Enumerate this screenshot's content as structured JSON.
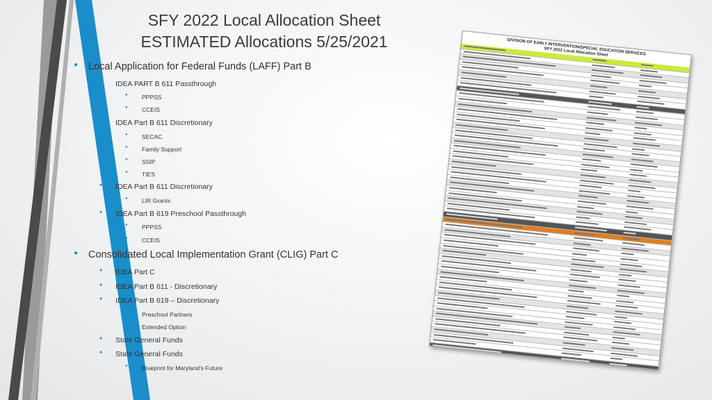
{
  "slide": {
    "title_line1": "SFY 2022 Local Allocation Sheet",
    "title_line2": "ESTIMATED Allocations 5/25/2021"
  },
  "outline": [
    {
      "level": 1,
      "text": "Local Application for Federal Funds (LAFF) Part B"
    },
    {
      "level": 2,
      "text": "IDEA PART B 611 Passthrough"
    },
    {
      "level": 3,
      "text": "PPPSS"
    },
    {
      "level": 3,
      "text": "CCEIS"
    },
    {
      "level": 2,
      "text": "IDEA Part B 611 Discretionary"
    },
    {
      "level": 3,
      "text": "SECAC"
    },
    {
      "level": 3,
      "text": "Family Support"
    },
    {
      "level": 3,
      "text": "SSIP"
    },
    {
      "level": 3,
      "text": "TIES"
    },
    {
      "level": 2,
      "text": "IDEA Part B 611 Discretionary"
    },
    {
      "level": 3,
      "text": "LIR Grants"
    },
    {
      "level": 2,
      "text": "IDEA Part B 619 Preschool Passthrough"
    },
    {
      "level": 3,
      "text": "PPPSS"
    },
    {
      "level": 3,
      "text": "CCEIS"
    },
    {
      "level": 1,
      "text": "Consolidated Local Implementation Grant (CLIG) Part C"
    },
    {
      "level": 2,
      "text": "IDEA Part C"
    },
    {
      "level": 2,
      "text": "IDEA Part B 611 - Discretionary"
    },
    {
      "level": 2,
      "text": "IDEA Part B 619 – Discretionary"
    },
    {
      "level": 3,
      "text": "Preschool Partners"
    },
    {
      "level": 3,
      "text": "Extended Option"
    },
    {
      "level": 2,
      "text": "State General Funds"
    },
    {
      "level": 2,
      "text": "State General Funds"
    },
    {
      "level": 3,
      "text": "Blueprint for Maryland’s Future"
    }
  ],
  "document_image": {
    "heading": "DIVISION OF EARLY INTERVENTION/SPECIAL EDUCATION SERVICES",
    "subheading": "SFY 2022 Local Allocation Sheet"
  },
  "colors": {
    "bullet": "#1a8ecb",
    "accent_blue": "#1a8ecb",
    "stripe_dark": "#4a4a4a",
    "stripe_gray": "#9a9a9a",
    "highlight_lime": "#c7ec3a",
    "highlight_orange": "#e47d1c"
  }
}
